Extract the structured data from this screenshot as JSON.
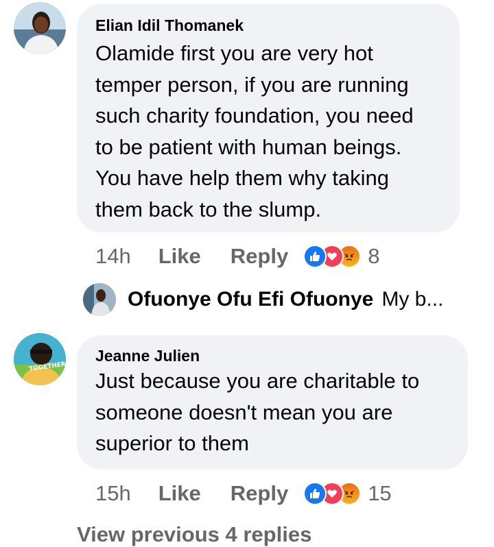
{
  "comments": [
    {
      "author": "Elian Idil Thomanek",
      "lines": [
        "Olamide first you are very hot",
        "temper person, if you are running",
        "such charity foundation, you need",
        "to be patient with human beings.",
        "You have help them why taking",
        "them back to the slump."
      ],
      "time": "14h",
      "like_label": "Like",
      "reply_label": "Reply",
      "reaction_count": "8",
      "reactions": [
        "like-icon",
        "love-icon",
        "angry-icon"
      ]
    },
    {
      "author": "Jeanne Julien",
      "avatar_badge": "TOGETHER",
      "lines": [
        "Just because you are charitable to",
        "someone doesn't mean you are",
        "superior to them"
      ],
      "time": "15h",
      "like_label": "Like",
      "reply_label": "Reply",
      "reaction_count": "15",
      "reactions": [
        "like-icon",
        "love-icon",
        "angry-icon"
      ]
    }
  ],
  "reply_preview": {
    "author": "Ofuonye Ofu Efi Ofuonye",
    "snippet": "My b..."
  },
  "view_more_label": "View previous 4 replies",
  "colors": {
    "bubble": "#f0f2f5",
    "meta_text": "#65676b",
    "like": "#1877f2",
    "love": "#f33e58",
    "angry": "#f7b125"
  }
}
